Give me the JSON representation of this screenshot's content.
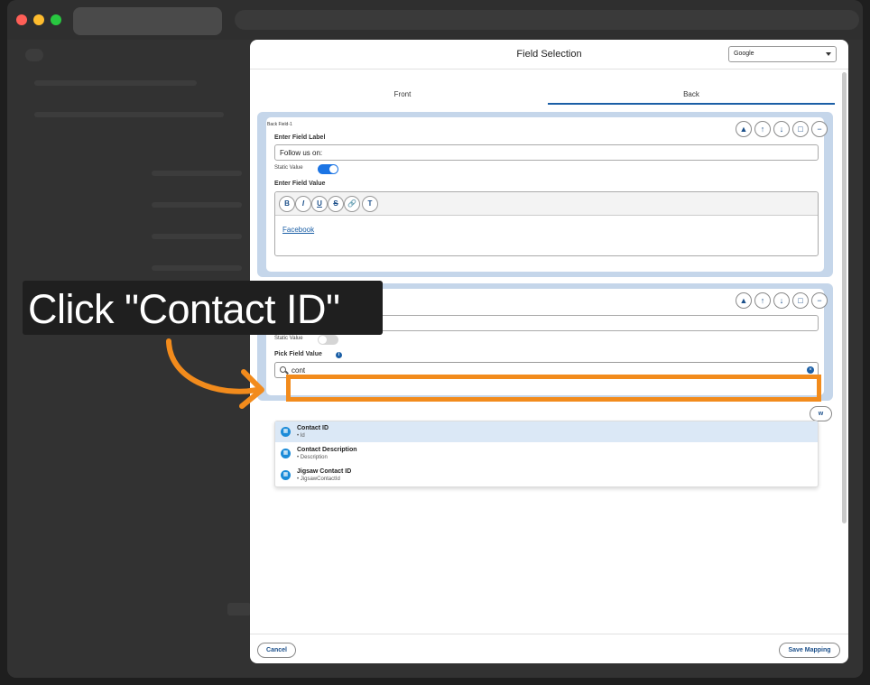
{
  "modal": {
    "title": "Field Selection",
    "object_select": "Google",
    "tabs": [
      "Front",
      "Back"
    ]
  },
  "card1": {
    "tag": "Back Field-1",
    "label_heading": "Enter Field Label",
    "label_value": "Follow us on:",
    "static_label": "Static Value",
    "static_on": true,
    "value_heading": "Enter Field Value",
    "toolbar": [
      "B",
      "I",
      "U",
      "S",
      "🔗",
      "T"
    ],
    "rte_link": "Facebook"
  },
  "card2": {
    "static_label": "Static Value",
    "static_on": false,
    "pick_heading": "Pick Field Value",
    "search_value": "cont"
  },
  "dropdown": [
    {
      "title": "Contact ID",
      "sub": "• Id"
    },
    {
      "title": "Contact Description",
      "sub": "• Description"
    },
    {
      "title": "Jigsaw Contact ID",
      "sub": "• JigsawContactId"
    }
  ],
  "footer": {
    "cancel": "Cancel",
    "save": "Save Mapping"
  },
  "overlay": {
    "instruction": "Click \"Contact ID\"",
    "accent": "#f28b1c"
  },
  "icons": [
    "bell-icon",
    "arrow-up-icon",
    "arrow-down-icon",
    "trash-icon",
    "minus-icon",
    "search-icon",
    "clear-icon",
    "table-icon"
  ]
}
